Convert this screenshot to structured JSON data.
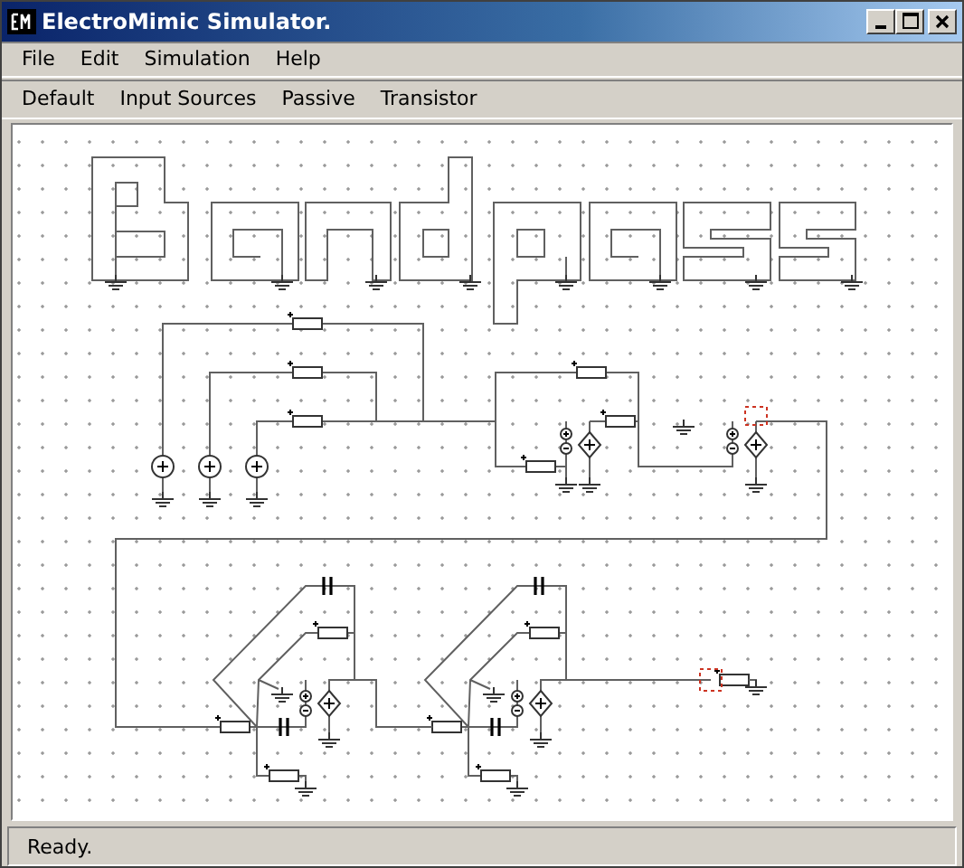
{
  "window": {
    "title": "ElectroMimic Simulator."
  },
  "menu": [
    "File",
    "Edit",
    "Simulation",
    "Help"
  ],
  "toolbar": [
    "Default",
    "Input Sources",
    "Passive",
    "Transistor"
  ],
  "status_bar": "Ready."
}
